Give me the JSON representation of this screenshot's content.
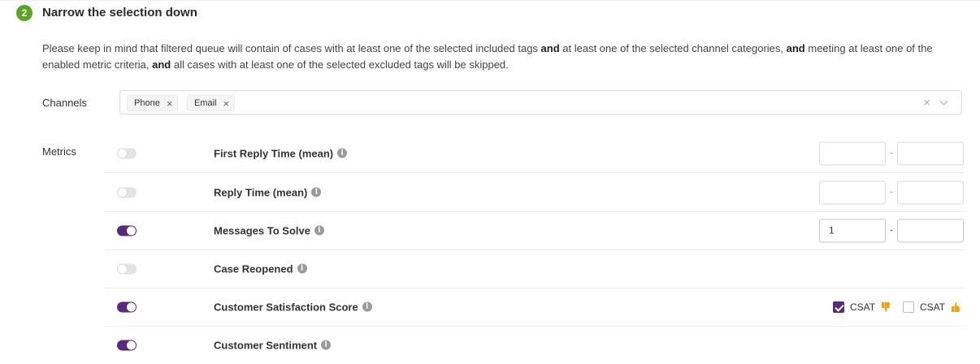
{
  "step": {
    "number": "2",
    "title": "Narrow the selection down"
  },
  "description": {
    "part1": "Please keep in mind that filtered queue will contain of cases with at least one of the selected included tags ",
    "and1": "and",
    "part2": " at least one of the selected channel categories, ",
    "and2": "and",
    "part3": " meeting at least one of the enabled metric criteria, ",
    "and3": "and",
    "part4": " all cases with at least one of the selected excluded tags will be skipped."
  },
  "channels": {
    "label": "Channels",
    "tags": [
      {
        "label": "Phone"
      },
      {
        "label": "Email"
      }
    ],
    "remove_glyph": "×",
    "clear_glyph": "×"
  },
  "metrics": {
    "label": "Metrics",
    "dash": "-",
    "rows": [
      {
        "name": "First Reply Time (mean)",
        "enabled": false,
        "min": "",
        "max": ""
      },
      {
        "name": "Reply Time (mean)",
        "enabled": false,
        "min": "",
        "max": ""
      },
      {
        "name": "Messages To Solve",
        "enabled": true,
        "min": "1",
        "max": ""
      },
      {
        "name": "Case Reopened",
        "enabled": false
      },
      {
        "name": "Customer Satisfaction Score",
        "enabled": true,
        "options": [
          {
            "label": "CSAT",
            "checked": true,
            "icon": "thumbs-down-icon"
          },
          {
            "label": "CSAT",
            "checked": false,
            "icon": "thumbs-up-icon"
          }
        ]
      },
      {
        "name": "Customer Sentiment",
        "enabled": true
      }
    ]
  },
  "colors": {
    "accent": "#5a2a7d",
    "step_badge": "#5aa621",
    "thumb": "#f0a30a"
  },
  "icons": {
    "info": "i"
  }
}
